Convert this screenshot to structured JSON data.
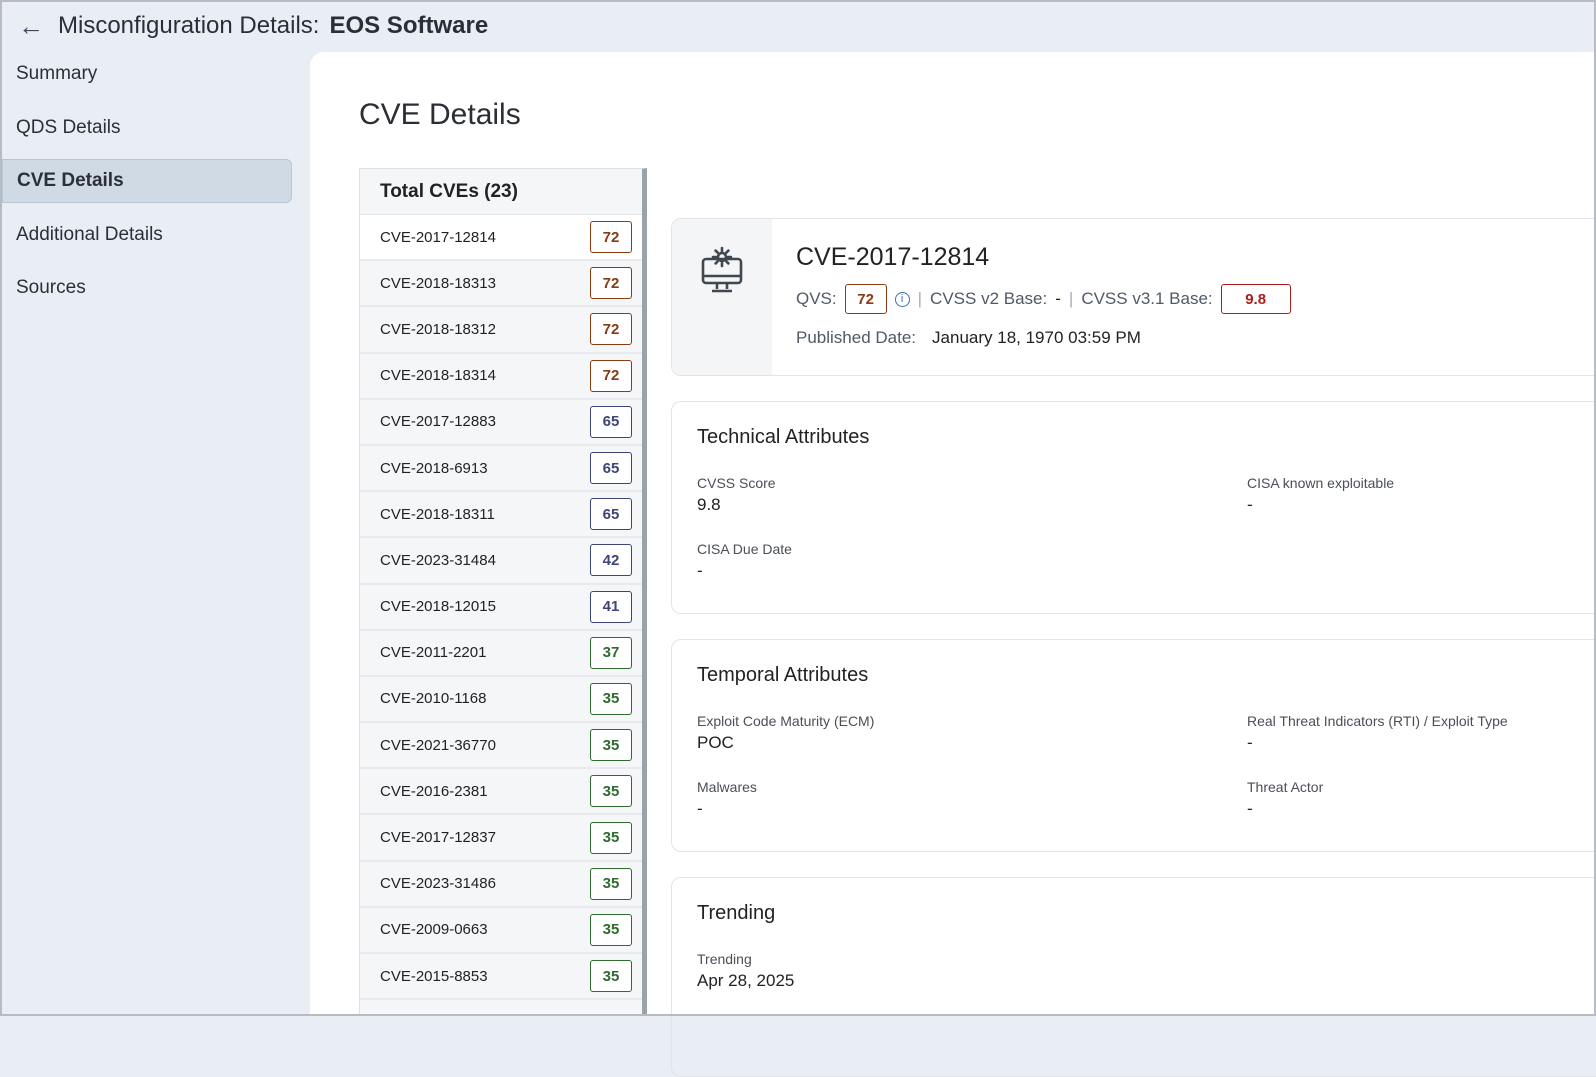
{
  "header": {
    "back_icon": "arrow-left-icon",
    "title": "Misconfiguration Details:",
    "subject": "EOS Software"
  },
  "sidebar": {
    "items": [
      {
        "label": "Summary"
      },
      {
        "label": "QDS Details"
      },
      {
        "label": "CVE Details",
        "active": true
      },
      {
        "label": "Additional Details"
      },
      {
        "label": "Sources"
      }
    ]
  },
  "page_title": "CVE Details",
  "cve_list": {
    "header": "Total CVEs (23)",
    "items": [
      {
        "id": "CVE-2017-12814",
        "score": "72",
        "level": "high"
      },
      {
        "id": "CVE-2018-18313",
        "score": "72",
        "level": "high"
      },
      {
        "id": "CVE-2018-18312",
        "score": "72",
        "level": "high"
      },
      {
        "id": "CVE-2018-18314",
        "score": "72",
        "level": "high"
      },
      {
        "id": "CVE-2017-12883",
        "score": "65",
        "level": "med"
      },
      {
        "id": "CVE-2018-6913",
        "score": "65",
        "level": "med"
      },
      {
        "id": "CVE-2018-18311",
        "score": "65",
        "level": "med"
      },
      {
        "id": "CVE-2023-31484",
        "score": "42",
        "level": "med"
      },
      {
        "id": "CVE-2018-12015",
        "score": "41",
        "level": "med"
      },
      {
        "id": "CVE-2011-2201",
        "score": "37",
        "level": "low"
      },
      {
        "id": "CVE-2010-1168",
        "score": "35",
        "level": "low"
      },
      {
        "id": "CVE-2021-36770",
        "score": "35",
        "level": "low"
      },
      {
        "id": "CVE-2016-2381",
        "score": "35",
        "level": "low"
      },
      {
        "id": "CVE-2017-12837",
        "score": "35",
        "level": "low"
      },
      {
        "id": "CVE-2023-31486",
        "score": "35",
        "level": "low"
      },
      {
        "id": "CVE-2009-0663",
        "score": "35",
        "level": "low"
      },
      {
        "id": "CVE-2015-8853",
        "score": "35",
        "level": "low"
      }
    ]
  },
  "colors": {
    "high": "#8b3a12",
    "med": "#3d4576",
    "low": "#2f6a2f",
    "critical": "#b01c1c"
  },
  "detail": {
    "icon": "monitor-gear-icon",
    "cve_id": "CVE-2017-12814",
    "qvs_label": "QVS:",
    "qvs": "72",
    "info_icon": "info-icon",
    "cvss2_label": "CVSS v2 Base:",
    "cvss2": "-",
    "cvss31_label": "CVSS v3.1 Base:",
    "cvss31": "9.8",
    "published_label": "Published Date:",
    "published": "January 18, 1970 03:59 PM"
  },
  "technical": {
    "title": "Technical Attributes",
    "fields": [
      {
        "label": "CVSS Score",
        "value": "9.8"
      },
      {
        "label": "CISA known exploitable",
        "value": "-"
      },
      {
        "label": "CISA Due Date",
        "value": "-"
      }
    ]
  },
  "temporal": {
    "title": "Temporal Attributes",
    "fields": [
      {
        "label": "Exploit Code Maturity (ECM)",
        "value": "POC"
      },
      {
        "label": "Real Threat Indicators (RTI) / Exploit Type",
        "value": "-"
      },
      {
        "label": "Malwares",
        "value": "-"
      },
      {
        "label": "Threat Actor",
        "value": "-"
      }
    ]
  },
  "trending": {
    "title": "Trending",
    "fields": [
      {
        "label": "Trending",
        "value": "Apr 28, 2025"
      }
    ]
  }
}
